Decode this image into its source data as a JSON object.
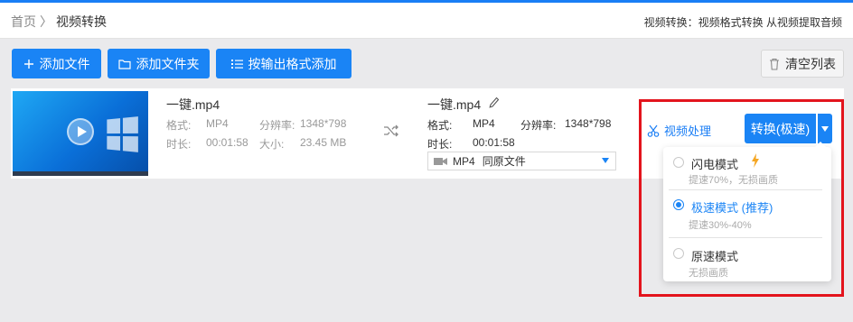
{
  "header": {
    "breadcrumb_home": "首页",
    "breadcrumb_sep": "〉",
    "breadcrumb_current": "视频转换",
    "right_text": "视频转换：视频格式转换 从视频提取音频"
  },
  "toolbar": {
    "add_file": "添加文件",
    "add_folder": "添加文件夹",
    "add_by_format": "按输出格式添加",
    "clear_list": "清空列表"
  },
  "file": {
    "name": "一键.mp4",
    "format_label": "格式:",
    "format_value": "MP4",
    "resolution_label": "分辨率:",
    "resolution_value": "1348*798",
    "duration_label": "时长:",
    "duration_value": "00:01:58",
    "size_label": "大小:",
    "size_value": "23.45 MB"
  },
  "output": {
    "name": "一键.mp4",
    "format_label": "格式:",
    "format_value": "MP4",
    "resolution_label": "分辨率:",
    "resolution_value": "1348*798",
    "duration_label": "时长:",
    "duration_value": "00:01:58",
    "select_format": "MP4",
    "select_option": "同原文件"
  },
  "actions": {
    "video_process": "视频处理",
    "convert": "转换(极速)"
  },
  "mode_menu": {
    "options": [
      {
        "title": "闪电模式",
        "desc": "提速70%，无损画质",
        "selected": false
      },
      {
        "title": "极速模式 (推荐)",
        "desc": "提速30%-40%",
        "selected": true
      },
      {
        "title": "原速模式",
        "desc": "无损画质",
        "selected": false
      }
    ]
  },
  "colors": {
    "accent": "#1a84f5",
    "highlight_border": "#e3141d",
    "bolt": "#f5a623"
  }
}
